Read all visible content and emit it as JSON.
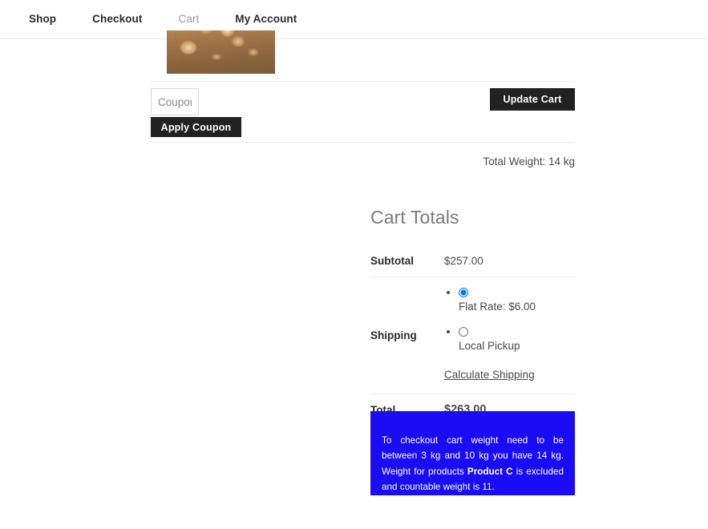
{
  "nav": {
    "items": [
      {
        "label": "Shop",
        "current": false
      },
      {
        "label": "Checkout",
        "current": false
      },
      {
        "label": "Cart",
        "current": true
      },
      {
        "label": "My Account",
        "current": false
      }
    ]
  },
  "cart": {
    "product_image_alt": "Walnuts on wooden table",
    "coupon": {
      "value": "",
      "placeholder": "Coupon code",
      "apply_label": "Apply Coupon"
    },
    "update_cart_label": "Update Cart",
    "total_weight": "Total Weight: 14 kg"
  },
  "totals": {
    "title": "Cart Totals",
    "subtotal_label": "Subtotal",
    "subtotal_value": "$257.00",
    "shipping_label": "Shipping",
    "shipping_methods": [
      {
        "label": "Flat Rate: $6.00",
        "selected": true
      },
      {
        "label": "Local Pickup",
        "selected": false
      }
    ],
    "calculate_shipping_label": "Calculate Shipping",
    "total_label": "Total",
    "total_value": "$263.00"
  },
  "notice": {
    "text_before": "To checkout cart weight need to be between 3 kg and 10 kg you have 14 kg. Weight for products",
    "product_name": "Product C",
    "text_after": "is excluded and countable weight is 11.",
    "background_color": "#1a0cf5",
    "text_color": "#ffffff"
  }
}
